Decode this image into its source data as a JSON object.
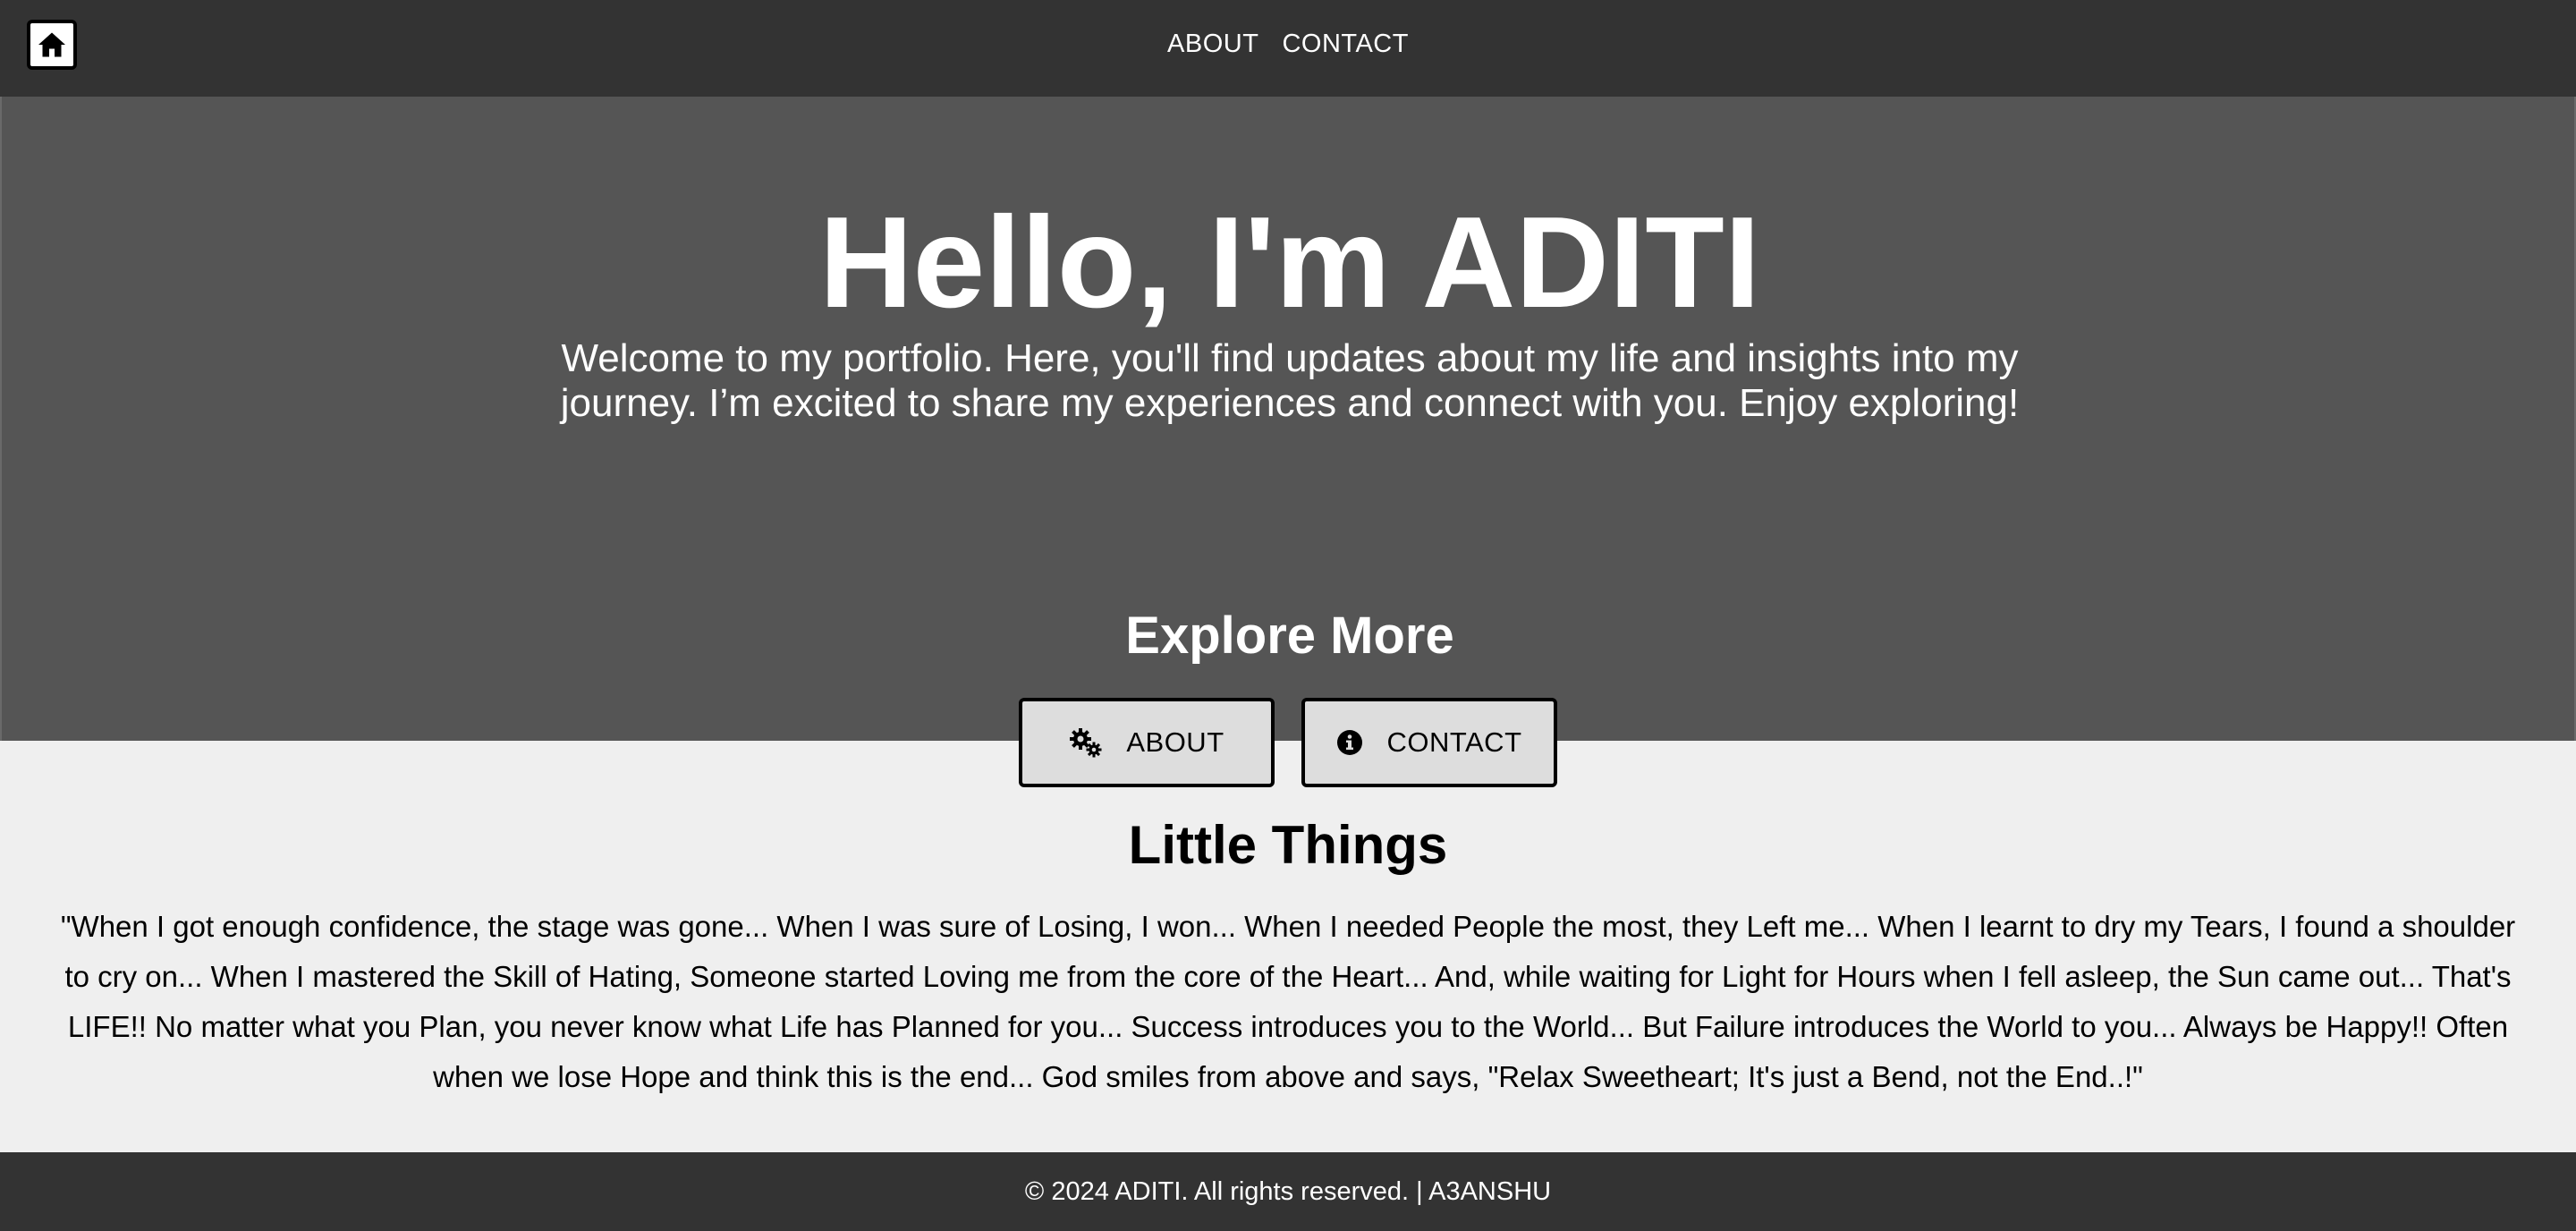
{
  "nav": {
    "home_icon": "home-icon",
    "links": [
      "ABOUT",
      "CONTACT"
    ]
  },
  "hero": {
    "title": "Hello, I'm ADITI",
    "text": "Welcome to my portfolio. Here, you'll find updates about my life and insights into my journey. I’m excited to share my experiences and connect with you. Enjoy exploring!",
    "explore_title": "Explore More"
  },
  "buttons": [
    {
      "label": "ABOUT",
      "icon": "gears-icon"
    },
    {
      "label": "CONTACT",
      "icon": "info-circle-icon"
    }
  ],
  "section": {
    "title": "Little Things",
    "quote": "\"When I got enough confidence, the stage was gone... When I was sure of Losing, I won... When I needed People the most, they Left me... When I learnt to dry my Tears, I found a shoulder to cry on... When I mastered the Skill of Hating, Someone started Loving me from the core of the Heart... And, while waiting for Light for Hours when I fell asleep, the Sun came out... That's LIFE!! No matter what you Plan, you never know what Life has Planned for you... Success introduces you to the World... But Failure introduces the World to you... Always be Happy!! Often when we lose Hope and think this is the end... God smiles from above and says, \"Relax Sweetheart; It's just a Bend, not the End..!\""
  },
  "footer": {
    "text": "© 2024 ADITI. All rights reserved. | A3ANSHU"
  },
  "colors": {
    "nav_bg": "#333333",
    "hero_bg": "#555555",
    "page_bg": "#efefef",
    "button_bg": "#dddddd",
    "text_light": "#ffffff",
    "text_dark": "#000000"
  }
}
